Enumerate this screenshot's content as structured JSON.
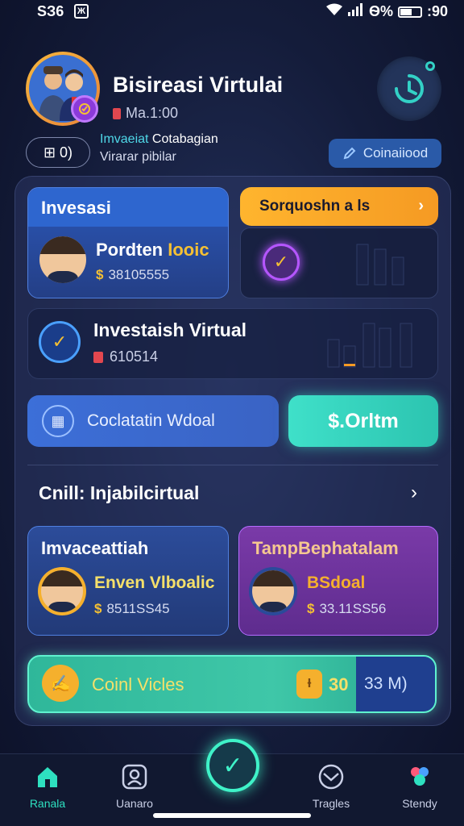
{
  "status_bar": {
    "time": "SЗ6",
    "notification": "Ж",
    "battery_text": "Ѳ%",
    "clock_right": ":90"
  },
  "header": {
    "title": "Bisireasi Virtulai",
    "subtitle": "Ma.1:00",
    "info_prefix": "Imvaeiat",
    "info_rest": "Cotabagian",
    "info_line2": "Virarar pibilar",
    "id_chip": "⊞ 0)",
    "confirm_button": "Coinaiiood"
  },
  "invest_card": {
    "title": "Invesasi",
    "name": "Pordten",
    "name_highlight": "Iooic",
    "value": "38105555",
    "coin_symbol": "$"
  },
  "side_card": {
    "label": "Sorquoshn a ls",
    "arrow": "›"
  },
  "row_card": {
    "title": "Investaish Virtual",
    "value": "610514"
  },
  "buttons": {
    "calc": "Coclatatin Wdoal",
    "amount": "$.Orltm"
  },
  "section": {
    "title": "Cnill: Injabilcirtual",
    "arrow": "›"
  },
  "card_blue": {
    "title": "Imvaceattiah",
    "name": "Enven Vlboalic",
    "value": "8511SS45"
  },
  "card_purple": {
    "title": "TampBephatalam",
    "name": "BSdoal",
    "value": "33.11SS56"
  },
  "coin_bar": {
    "label": "Coinl Vicles",
    "coin_symbol": "Ɨ",
    "number": "30",
    "number2": "33 M)"
  },
  "bottom_nav": {
    "items": [
      {
        "label": "Ranala",
        "icon": "home-icon"
      },
      {
        "label": "Uanaro",
        "icon": "profile-icon"
      },
      {
        "label": "Tragles",
        "icon": "trades-icon"
      },
      {
        "label": "Stendy",
        "icon": "study-icon"
      }
    ]
  },
  "colors": {
    "accent_teal": "#3ff2c8",
    "accent_orange": "#f59a23",
    "accent_purple": "#b556ff",
    "primary_blue": "#2e66cf"
  }
}
